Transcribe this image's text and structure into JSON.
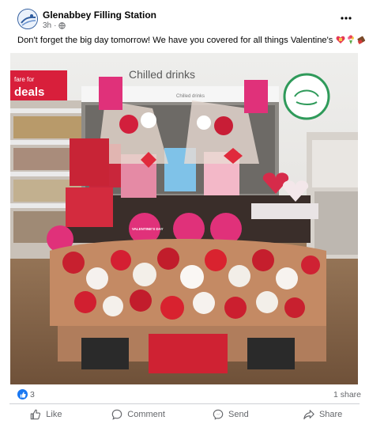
{
  "post": {
    "page_name": "Glenabbey Filling Station",
    "time": "3h",
    "privacy_icon": "globe-icon",
    "more_icon": "more-options-icon",
    "text": "Don't forget the big day tomorrow! We have you covered for all things Valentine's",
    "text_emojis": [
      "heart-gift-icon",
      "bouquet-icon",
      "chocolate-icon"
    ]
  },
  "photo": {
    "store_sign": "Chilled drinks",
    "sign_left": "fare for",
    "sign_left_big": "deals",
    "sign_right": "Chilled drinks",
    "stand_sign": "VALENTINE'S DAY",
    "accent_color": "#e0317a",
    "floor_color": "#8a6a4e"
  },
  "reactions": {
    "reaction_icon": "like-reaction-icon",
    "count": "3",
    "shares": "1 share"
  },
  "actions": {
    "like": "Like",
    "comment": "Comment",
    "send": "Send",
    "share": "Share"
  }
}
